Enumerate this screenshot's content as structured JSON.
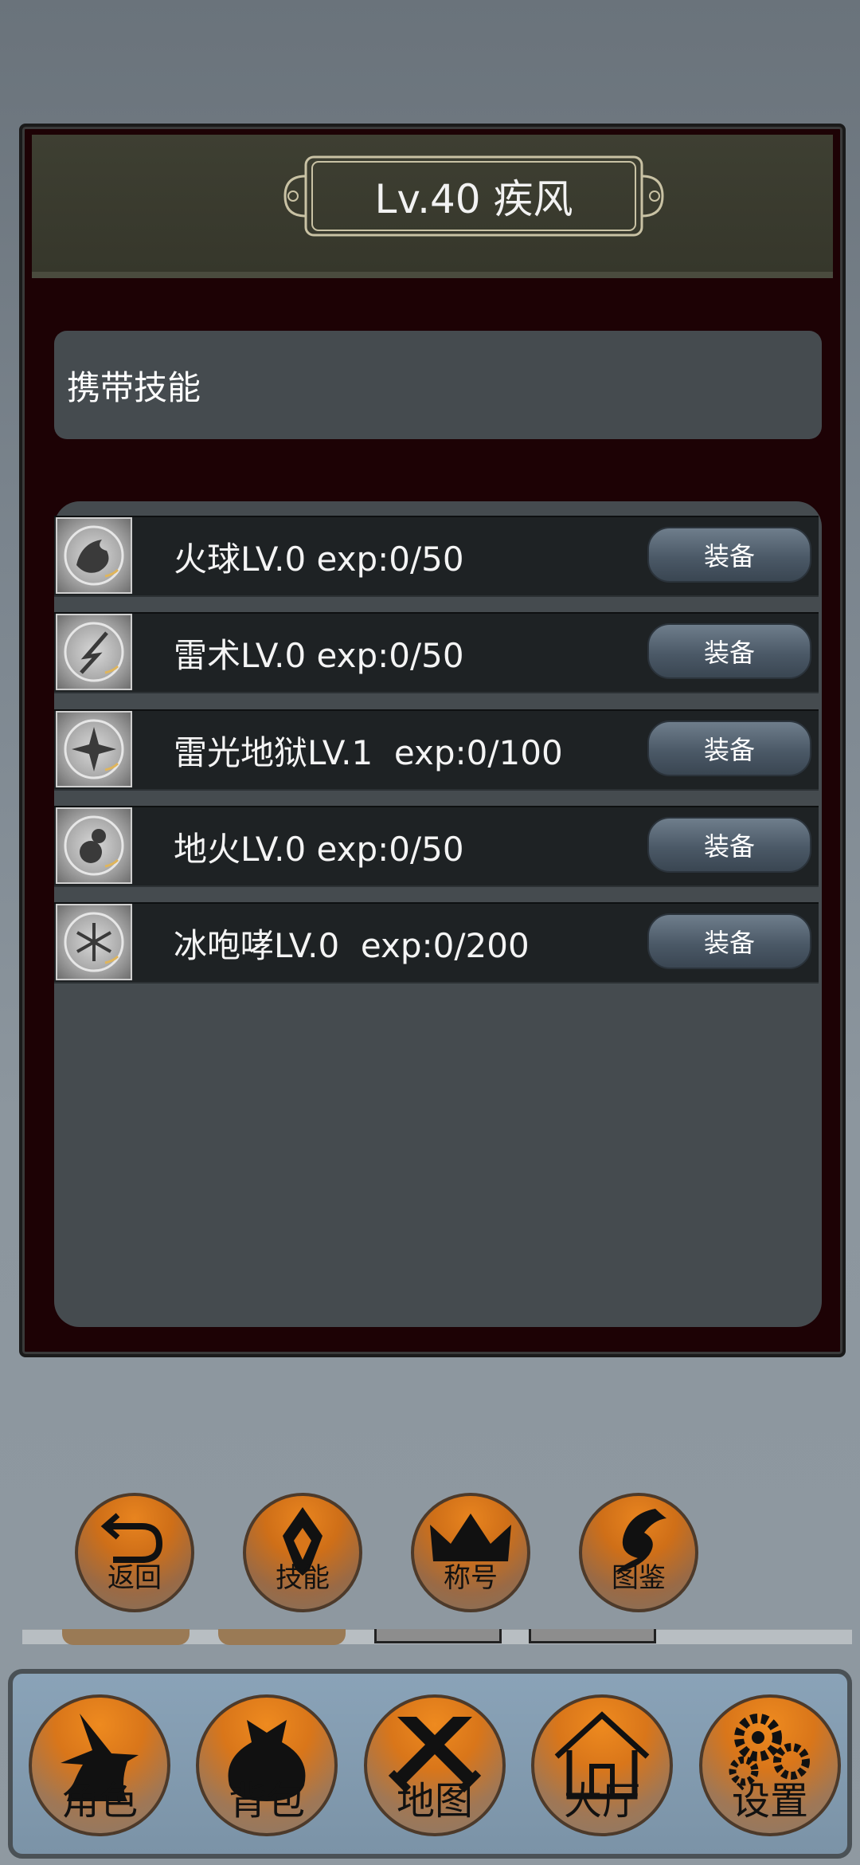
{
  "title": "Lv.40 疾风",
  "section_label": "携带技能",
  "skills": [
    {
      "name": "火球LV.0 exp:0/50",
      "icon": "fireball-icon",
      "button": "装备"
    },
    {
      "name": "雷术LV.0 exp:0/50",
      "icon": "thunder-icon",
      "button": "装备"
    },
    {
      "name": "雷光地狱LV.1  exp:0/100",
      "icon": "lightning-hell-icon",
      "button": "装备"
    },
    {
      "name": "地火LV.0 exp:0/50",
      "icon": "earth-fire-icon",
      "button": "装备"
    },
    {
      "name": "冰咆哮LV.0  exp:0/200",
      "icon": "ice-roar-icon",
      "button": "装备"
    }
  ],
  "sub_nav": [
    {
      "label": "返回",
      "icon": "back-arrow-icon"
    },
    {
      "label": "技能",
      "icon": "skill-emblem-icon"
    },
    {
      "label": "称号",
      "icon": "crown-icon"
    },
    {
      "label": "图鉴",
      "icon": "dragon-icon"
    }
  ],
  "bottom_nav": [
    {
      "label": "角色",
      "icon": "wizard-icon"
    },
    {
      "label": "背包",
      "icon": "bag-icon"
    },
    {
      "label": "地图",
      "icon": "crossed-swords-icon"
    },
    {
      "label": "大厅",
      "icon": "house-icon"
    },
    {
      "label": "设置",
      "icon": "gears-icon"
    }
  ],
  "colors": {
    "panel_bg": "#1d0205",
    "header_bg": "#3e3f32",
    "list_bg": "#454b4f",
    "row_bg": "#1e2224",
    "button_orange": "#e8841f",
    "nav_bar": "#8aa3b8"
  }
}
